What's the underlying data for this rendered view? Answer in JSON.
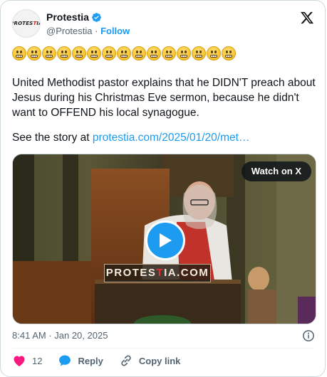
{
  "author": {
    "name": "Protestia",
    "handle": "@Protestia",
    "separator": " · ",
    "follow_label": "Follow",
    "avatar_text_a": "PROTES",
    "avatar_text_b": "T",
    "avatar_text_c": "IA"
  },
  "tweet": {
    "emoji_count": 15,
    "emoji_name": "grimacing-face",
    "text": "United Methodist pastor explains that he DIDN'T preach about Jesus during his Christmas Eve sermon, because he didn't want to OFFEND his local synagogue.",
    "story_prefix": "See the story  at ",
    "story_link": "protestia.com/2025/01/20/met…"
  },
  "media": {
    "watch_label": "Watch on X",
    "watermark_a": "PROTES",
    "watermark_b": "T",
    "watermark_c": "IA.COM"
  },
  "meta": {
    "timestamp": "8:41 AM · Jan 20, 2025"
  },
  "actions": {
    "like_count": "12",
    "reply_label": "Reply",
    "copy_label": "Copy link"
  },
  "colors": {
    "accent": "#1d9bf0",
    "like": "#f91880",
    "text": "#0f1419",
    "muted": "#536471"
  }
}
